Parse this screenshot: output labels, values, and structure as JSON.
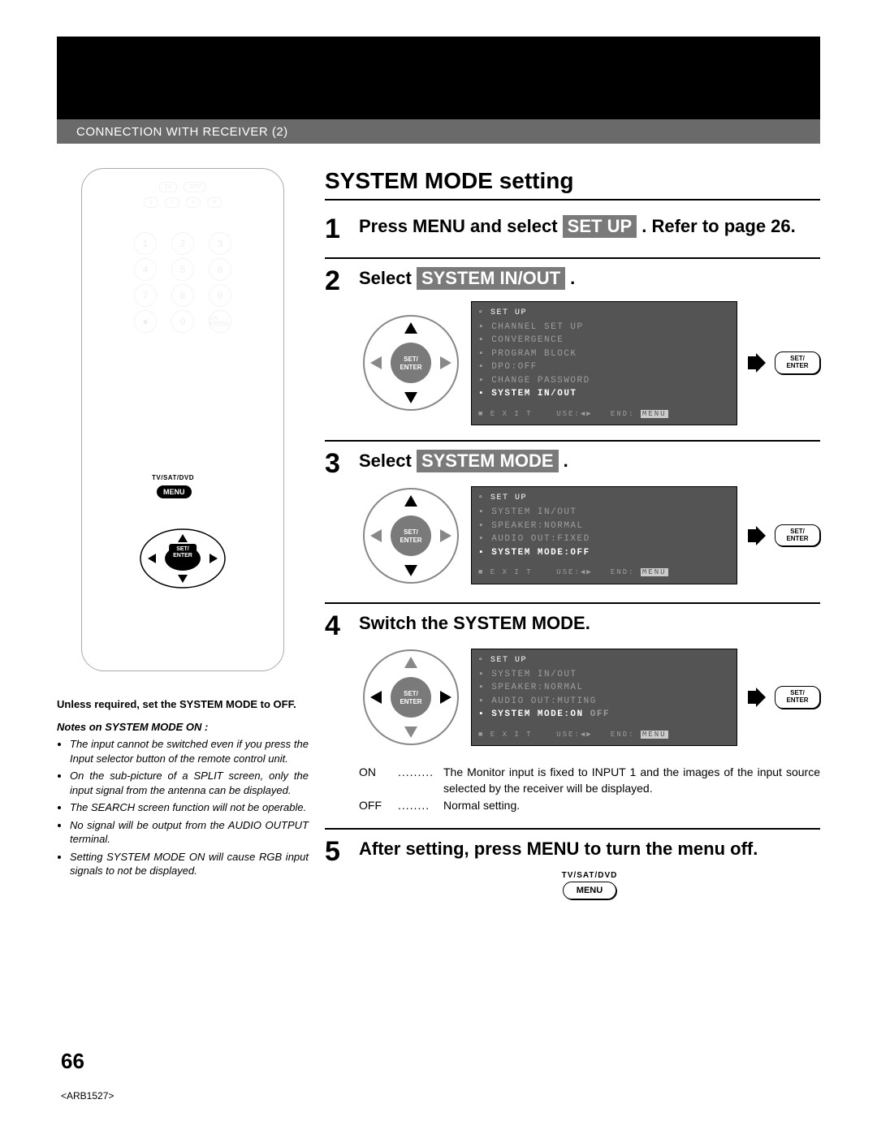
{
  "header": {
    "subtitle": "CONNECTION WITH RECEIVER (2)"
  },
  "section_title": "SYSTEM MODE setting",
  "steps": {
    "s1": {
      "num": "1",
      "pre": "Press MENU and select ",
      "chip": "SET UP",
      "post": " . Refer to page 26."
    },
    "s2": {
      "num": "2",
      "pre": "Select ",
      "chip": "SYSTEM IN/OUT",
      "post": " ."
    },
    "s3": {
      "num": "3",
      "pre": "Select ",
      "chip": "SYSTEM MODE",
      "post": " ."
    },
    "s4": {
      "num": "4",
      "heading": "Switch the SYSTEM MODE."
    },
    "s5": {
      "num": "5",
      "heading": "After setting, press MENU to turn the menu off."
    }
  },
  "osd": {
    "setup_label": "SET UP",
    "menu1": {
      "l1": "CHANNEL SET UP",
      "l2": "CONVERGENCE",
      "l3": "PROGRAM BLOCK",
      "l4": "DPO:OFF",
      "l5": "CHANGE PASSWORD",
      "l6": "SYSTEM IN/OUT"
    },
    "menu2": {
      "l1": "SYSTEM IN/OUT",
      "l2": "SPEAKER:NORMAL",
      "l3": "AUDIO OUT:FIXED",
      "l4": "SYSTEM MODE:OFF"
    },
    "menu3": {
      "l1": "SYSTEM IN/OUT",
      "l2": "SPEAKER:NORMAL",
      "l3": "AUDIO OUT:MUTING",
      "l4pre": "SYSTEM MODE:",
      "l4on": "ON",
      "l4off": "OFF"
    },
    "footer_exit": "■ E X I T",
    "footer_use": "USE:",
    "footer_end": "END:",
    "footer_menu": "MENU"
  },
  "set_enter": "SET/ ENTER",
  "remote": {
    "menu_cat": "TV/SAT/DVD",
    "menu": "MENU",
    "set": "SET/",
    "enter": "ENTER"
  },
  "on_off": {
    "on_key": "ON",
    "on_val": "The Monitor input is fixed to INPUT 1 and the images of the input source selected by the receiver will be displayed.",
    "off_key": "OFF",
    "off_val": "Normal setting.",
    "dots": "........."
  },
  "notes": {
    "lead": "Unless required, set the SYSTEM MODE to OFF.",
    "title": "Notes on SYSTEM MODE ON :",
    "items": [
      "The input cannot be switched even if you press the Input selector button of the remote control unit.",
      "On the sub-picture of a SPLIT screen, only the input signal from the antenna can be displayed.",
      "The SEARCH screen function will not be operable.",
      "No signal will be output from the AUDIO OUTPUT terminal.",
      "Setting SYSTEM MODE ON will cause RGB input signals to not be displayed."
    ]
  },
  "menu_button": {
    "label": "TV/SAT/DVD",
    "text": "MENU"
  },
  "footer": {
    "page_num": "66",
    "code": "<ARB1527>"
  }
}
